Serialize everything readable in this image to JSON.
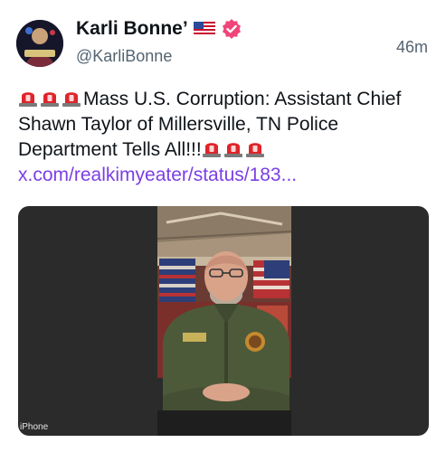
{
  "post": {
    "display_name": "Karli Bonne’",
    "handle": "@KarliBonne",
    "time": "46m",
    "text_main": "Mass U.S. Corruption: Assistant Chief Shawn Taylor of Millersville, TN Police Department Tells All!!!",
    "link_text": "x.com/realkimyeater/status/183...",
    "media_caption": "iPhone"
  },
  "colors": {
    "link": "#7b3fe4",
    "badge": "#f0447a",
    "handle": "#536471"
  },
  "icons": {
    "flag": "us-flag-icon",
    "badge": "verified-badge-icon",
    "siren": "siren-icon"
  }
}
